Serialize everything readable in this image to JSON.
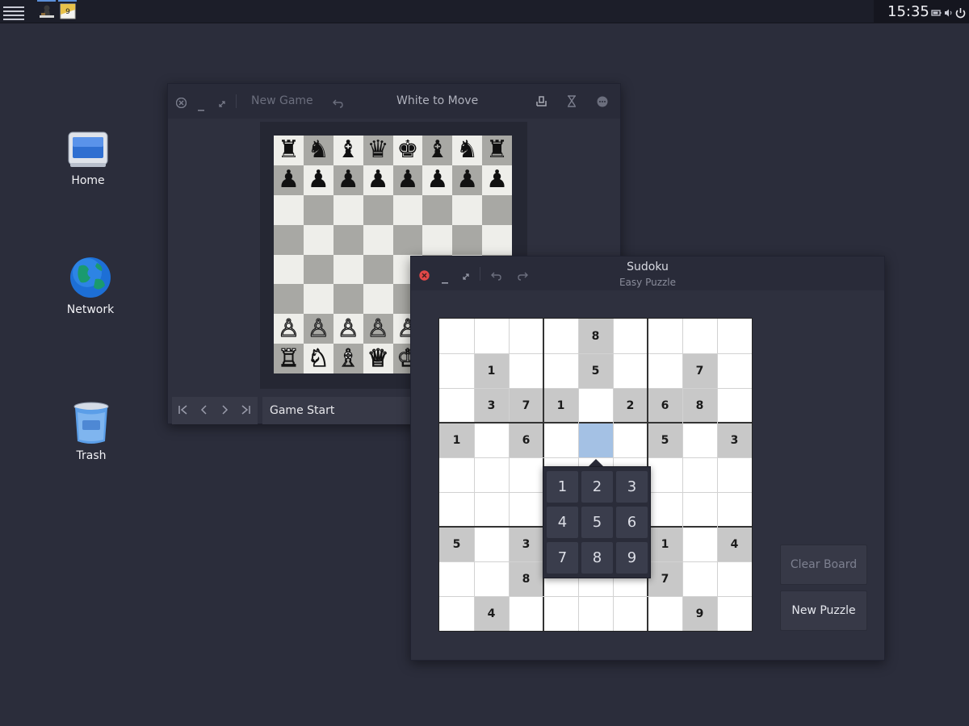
{
  "panel": {
    "clock": "15:35",
    "accent": "#5b8fd8",
    "icons": [
      "menu-icon",
      "chess-app-icon",
      "sudoku-app-icon",
      "battery-icon",
      "volume-icon",
      "power-icon"
    ]
  },
  "desktop": {
    "icons": [
      {
        "label": "Home",
        "icon": "computer-icon"
      },
      {
        "label": "Network",
        "icon": "globe-icon"
      },
      {
        "label": "Trash",
        "icon": "trash-icon"
      }
    ]
  },
  "chess": {
    "title": "White to Move",
    "new_game": "New Game",
    "status": "Game Start",
    "board": [
      [
        "♜",
        "♞",
        "♝",
        "♛",
        "♚",
        "♝",
        "♞",
        "♜"
      ],
      [
        "♟",
        "♟",
        "♟",
        "♟",
        "♟",
        "♟",
        "♟",
        "♟"
      ],
      [
        "",
        "",
        "",
        "",
        "",
        "",
        "",
        ""
      ],
      [
        "",
        "",
        "",
        "",
        "",
        "",
        "",
        ""
      ],
      [
        "",
        "",
        "",
        "",
        "",
        "",
        "",
        ""
      ],
      [
        "",
        "",
        "",
        "",
        "",
        "",
        "",
        ""
      ],
      [
        "♙",
        "♙",
        "♙",
        "♙",
        "♙",
        "♙",
        "♙",
        "♙"
      ],
      [
        "♖",
        "♘",
        "♗",
        "♕",
        "♔",
        "♗",
        "♘",
        "♖"
      ]
    ]
  },
  "sudoku": {
    "title": "Sudoku",
    "subtitle": "Easy Puzzle",
    "grid": [
      [
        "",
        "",
        "",
        "",
        "8",
        "",
        "",
        "",
        ""
      ],
      [
        "",
        "1",
        "",
        "",
        "5",
        "",
        "",
        "7",
        ""
      ],
      [
        "",
        "3",
        "7",
        "1",
        "",
        "2",
        "6",
        "8",
        ""
      ],
      [
        "1",
        "",
        "6",
        "",
        "",
        "",
        "5",
        "",
        "3"
      ],
      [
        "",
        "",
        "",
        "",
        "",
        "",
        "",
        "",
        ""
      ],
      [
        "",
        "",
        "",
        "",
        "",
        "",
        "",
        "",
        ""
      ],
      [
        "5",
        "",
        "3",
        "",
        "",
        "",
        "1",
        "",
        "4"
      ],
      [
        "",
        "",
        "8",
        "",
        "",
        "",
        "7",
        "",
        ""
      ],
      [
        "",
        "4",
        "",
        "",
        "",
        "",
        "",
        "9",
        ""
      ]
    ],
    "shaded": [
      [
        0,
        4
      ],
      [
        1,
        1
      ],
      [
        1,
        4
      ],
      [
        1,
        7
      ],
      [
        2,
        1
      ],
      [
        2,
        2
      ],
      [
        2,
        3
      ],
      [
        2,
        5
      ],
      [
        2,
        6
      ],
      [
        2,
        7
      ],
      [
        3,
        0
      ],
      [
        3,
        2
      ],
      [
        3,
        6
      ],
      [
        3,
        8
      ],
      [
        6,
        0
      ],
      [
        6,
        2
      ],
      [
        6,
        6
      ],
      [
        6,
        8
      ],
      [
        7,
        2
      ],
      [
        7,
        6
      ],
      [
        8,
        1
      ],
      [
        8,
        7
      ]
    ],
    "selected": [
      3,
      4
    ],
    "numpad": [
      "1",
      "2",
      "3",
      "4",
      "5",
      "6",
      "7",
      "8",
      "9"
    ],
    "clear_board": "Clear Board",
    "new_puzzle": "New Puzzle"
  }
}
